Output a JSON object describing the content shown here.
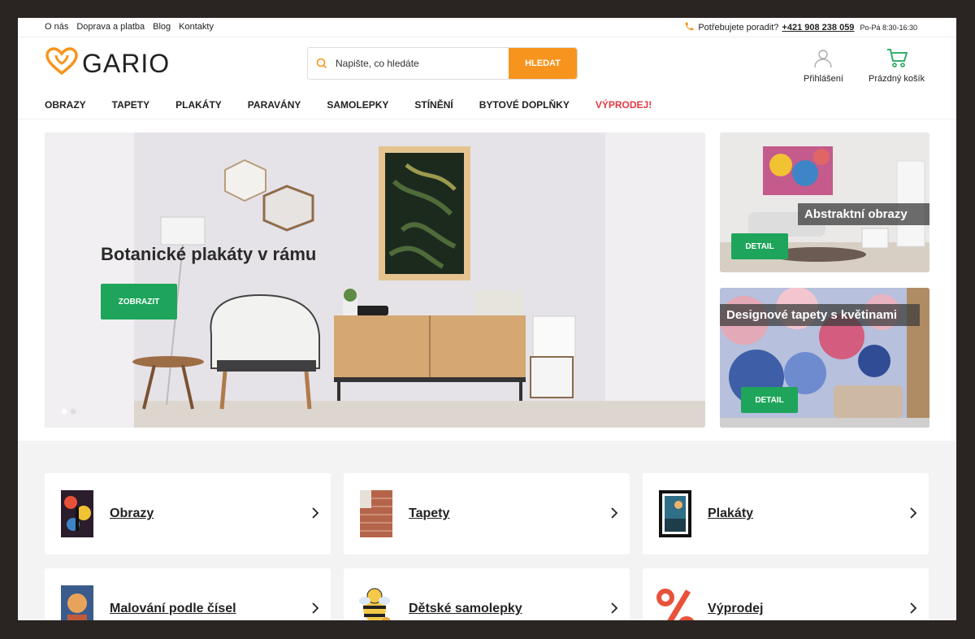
{
  "topbar": {
    "links": [
      "O nás",
      "Doprava a platba",
      "Blog",
      "Kontakty"
    ],
    "phone_label": "Potřebujete poradit?",
    "phone_number": "+421 908 238 059",
    "hours": "Po-Pá 8:30-16:30"
  },
  "header": {
    "logo_text": "GARIO",
    "search_placeholder": "Napište, co hledáte",
    "search_button": "HLEDAT",
    "login_label": "Přihlášení",
    "cart_label": "Prázdný košík"
  },
  "nav": {
    "items": [
      "OBRAZY",
      "TAPETY",
      "PLAKÁTY",
      "PARAVÁNY",
      "SAMOLEPKY",
      "STÍNĚNÍ",
      "BYTOVÉ DOPLŇKY"
    ],
    "sale": "VÝPRODEJ!"
  },
  "hero": {
    "title": "Botanické plakáty v rámu",
    "button": "ZOBRAZIT"
  },
  "side_banners": [
    {
      "title": "Abstraktní obrazy",
      "button": "DETAIL"
    },
    {
      "title": "Designové tapety s květinami",
      "button": "DETAIL"
    }
  ],
  "categories": [
    {
      "label": "Obrazy"
    },
    {
      "label": "Tapety"
    },
    {
      "label": "Plakáty"
    },
    {
      "label": "Malování podle čísel"
    },
    {
      "label": "Dětské samolepky"
    },
    {
      "label": "Výprodej"
    }
  ],
  "colors": {
    "accent": "#f7941d",
    "green": "#1ea55b",
    "sale": "#e63946"
  }
}
